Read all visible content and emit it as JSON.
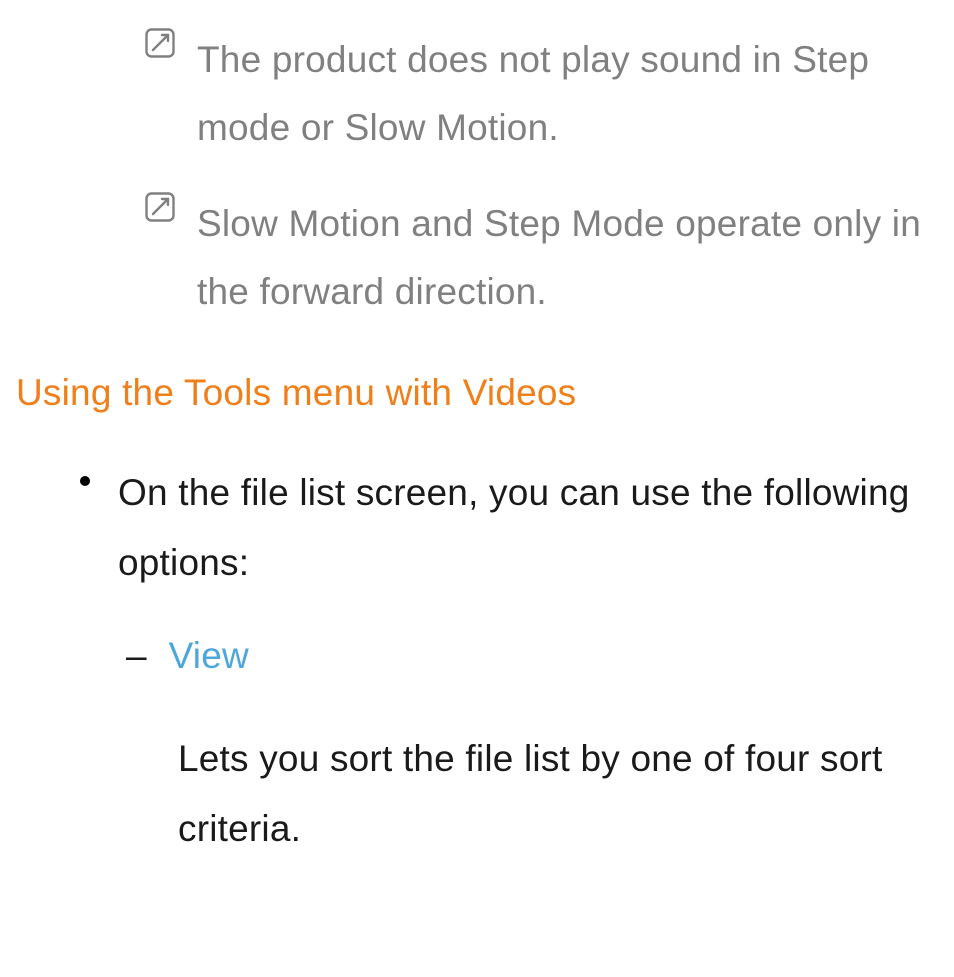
{
  "notes": [
    "The product does not play sound in Step mode or Slow Motion.",
    "Slow Motion and Step Mode operate only in the forward direction."
  ],
  "section_heading": "Using the Tools menu with Videos",
  "bullet_intro": "On the file list screen, you can use the following options:",
  "dash": {
    "mark": "–",
    "label": "View",
    "body": "Lets you sort the file list by one of four sort criteria."
  }
}
